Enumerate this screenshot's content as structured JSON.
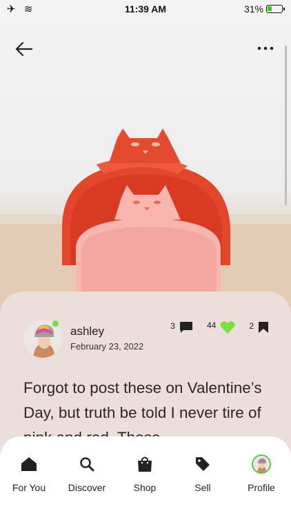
{
  "status_bar": {
    "time": "11:39 AM",
    "battery": "31%",
    "battery_level": 0.31
  },
  "post": {
    "username": "ashley",
    "date": "February 23, 2022",
    "comments_count": "3",
    "likes_count": "44",
    "saves_count": "2",
    "text": "Forgot to post these on Valentine’s Day, but truth be told I never tire of pink and red. These"
  },
  "nav": {
    "items": [
      {
        "label": "For You",
        "icon": "home-icon"
      },
      {
        "label": "Discover",
        "icon": "search-icon"
      },
      {
        "label": "Shop",
        "icon": "shopping-bag-icon"
      },
      {
        "label": "Sell",
        "icon": "tag-icon"
      },
      {
        "label": "Profile",
        "icon": "avatar"
      }
    ]
  },
  "colors": {
    "like": "#79e23a",
    "card_bg": "#ebdedb",
    "nav_bg": "#ffffff"
  }
}
